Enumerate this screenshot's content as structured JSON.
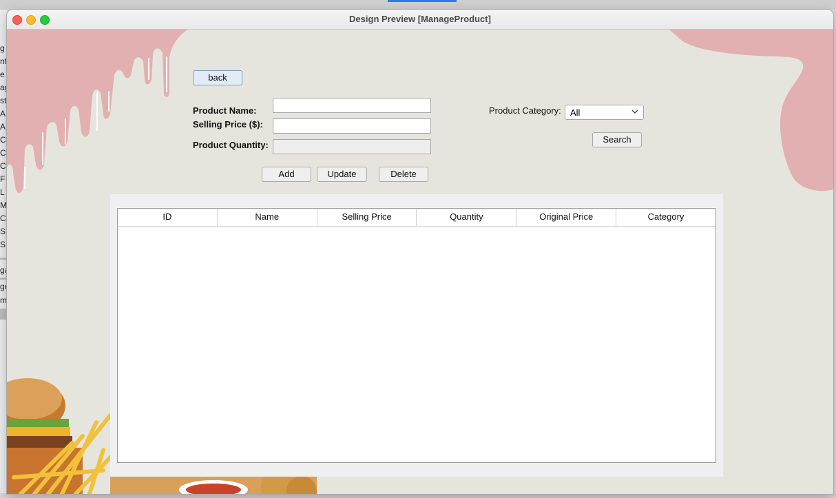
{
  "window": {
    "title": "Design Preview [ManageProduct]"
  },
  "background_sidebar": [
    "g",
    "nt",
    "e",
    "ag",
    "sta",
    "A",
    "A",
    "C",
    "C",
    "C",
    "F",
    "L",
    "M",
    "C",
    "S",
    "S",
    "ga",
    "ge",
    "m"
  ],
  "buttons": {
    "back": "back",
    "add": "Add",
    "update": "Update",
    "delete": "Delete",
    "search": "Search"
  },
  "form": {
    "product_name": {
      "label": "Product Name:",
      "value": ""
    },
    "selling_price": {
      "label": "Selling Price ($):",
      "value": ""
    },
    "product_quantity": {
      "label": "Product Quantity:",
      "value": "",
      "enabled": false
    }
  },
  "filter": {
    "label": "Product Category:",
    "selected": "All",
    "icon": "chevron-down-icon"
  },
  "table": {
    "columns": [
      "ID",
      "Name",
      "Selling Price",
      "Quantity",
      "Original Price",
      "Category"
    ],
    "rows": []
  },
  "colors": {
    "window_background": "#e6e5dd",
    "drip_pink": "#e3b0b2",
    "table_panel": "#f0f0f0",
    "back_button_border": "#7c9cc6"
  }
}
